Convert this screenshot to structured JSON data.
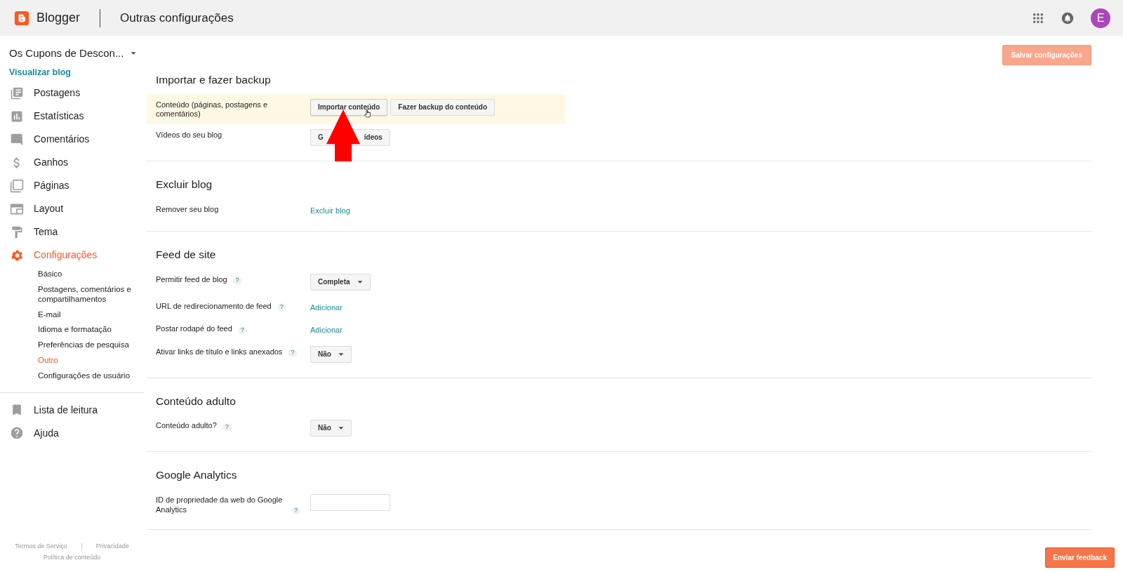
{
  "header": {
    "brand": "Blogger",
    "page_title": "Outras configurações",
    "avatar_letter": "E"
  },
  "sidebar": {
    "blog_name": "Os Cupons de Descon...",
    "view_link": "Visualizar blog",
    "items": [
      {
        "label": "Postagens",
        "selected": false
      },
      {
        "label": "Estatísticas",
        "selected": false
      },
      {
        "label": "Comentários",
        "selected": false
      },
      {
        "label": "Ganhos",
        "selected": false
      },
      {
        "label": "Páginas",
        "selected": false
      },
      {
        "label": "Layout",
        "selected": false
      },
      {
        "label": "Tema",
        "selected": false
      },
      {
        "label": "Configurações",
        "selected": true,
        "children": [
          {
            "label": "Básico",
            "selected": false
          },
          {
            "label": "Postagens, comentários e compartilhamentos",
            "selected": false
          },
          {
            "label": "E-mail",
            "selected": false
          },
          {
            "label": "Idioma e formatação",
            "selected": false
          },
          {
            "label": "Preferências de pesquisa",
            "selected": false
          },
          {
            "label": "Outro",
            "selected": true
          },
          {
            "label": "Configurações de usuário",
            "selected": false
          }
        ]
      }
    ],
    "bottom_items": [
      {
        "label": "Lista de leitura"
      },
      {
        "label": "Ajuda"
      }
    ],
    "footer_links": [
      "Termos de Serviço",
      "Privacidade",
      "Política de conteúdo"
    ]
  },
  "save_button": {
    "label": "Salvar configurações",
    "disabled": true
  },
  "sections": [
    {
      "title": "Importar e fazer backup",
      "rows": [
        {
          "label": "Conteúdo (páginas, postagens e comentários)",
          "highlighted": true,
          "controls": [
            {
              "kind": "button",
              "label": "Importar conteúdo",
              "hovered": true
            },
            {
              "kind": "button",
              "label": "Fazer backup do conteúdo"
            }
          ]
        },
        {
          "label": "Vídeos do seu blog",
          "highlighted": false,
          "controls": [
            {
              "kind": "covered-button",
              "parts": [
                "G",
                "ídeos"
              ]
            }
          ]
        }
      ]
    },
    {
      "title": "Excluir blog",
      "rows": [
        {
          "label": "Remover seu blog",
          "highlighted": false,
          "controls": [
            {
              "kind": "link",
              "label": "Excluir blog"
            }
          ]
        }
      ]
    },
    {
      "title": "Feed de site",
      "rows": [
        {
          "label": "Permitir feed de blog",
          "help": "?",
          "highlighted": false,
          "controls": [
            {
              "kind": "dropdown",
              "label": "Completa"
            }
          ]
        },
        {
          "label": "URL de redirecionamento de feed",
          "help": "?",
          "highlighted": false,
          "controls": [
            {
              "kind": "link",
              "label": "Adicionar"
            }
          ]
        },
        {
          "label": "Postar rodapé do feed",
          "help": "?",
          "highlighted": false,
          "controls": [
            {
              "kind": "link",
              "label": "Adicionar"
            }
          ]
        },
        {
          "label": "Ativar links de título e links anexados",
          "help": "?",
          "highlighted": false,
          "controls": [
            {
              "kind": "dropdown",
              "label": "Não"
            }
          ]
        }
      ]
    },
    {
      "title": "Conteúdo adulto",
      "rows": [
        {
          "label": "Conteúdo adulto?",
          "help": "?",
          "highlighted": false,
          "controls": [
            {
              "kind": "dropdown",
              "label": "Não"
            }
          ]
        }
      ]
    },
    {
      "title": "Google Analytics",
      "rows": [
        {
          "label": "ID de propriedade da web do Google Analytics",
          "help": "?",
          "highlighted": false,
          "controls": [
            {
              "kind": "input"
            }
          ]
        }
      ]
    }
  ],
  "annotation": {
    "kind": "arrow"
  },
  "feedback_button": {
    "label": "Enviar feedback"
  }
}
